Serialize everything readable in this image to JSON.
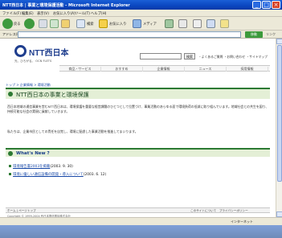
{
  "window": {
    "title": "NTT西日本 | 事業と環境保護活動 - Microsoft Internet Explorer",
    "controls": {
      "minimize": "_",
      "maximize": "□",
      "close": "×"
    }
  },
  "menu": [
    "ファイル(F)",
    "編集(E)",
    "表示(V)",
    "お気に入り(A)",
    "ツール(T)",
    "ヘルプ(H)"
  ],
  "toolbar": {
    "back_label": "戻る",
    "search_label": "検索",
    "favorites_label": "お気に入り",
    "media_label": "メディア"
  },
  "address": {
    "label": "アドレス(D)",
    "go_label": "移動",
    "links_label": "リンク"
  },
  "page": {
    "logo_name": "NTT西日本",
    "logo_sub": "光、ひろがる。 OCN FLETS",
    "search_button": "検索",
    "top_links": "・よくあるご質問 ・お問い合わせ ・サイトマップ",
    "global_nav": [
      "商品・サービス",
      "おすすめ",
      "企業情報",
      "ニュース",
      "採用情報"
    ],
    "breadcrumb": "トップ > 企業情報 > 環境活動",
    "heading": "NTT西日本の事業と環境保護",
    "para1": "西日本地域の通信事業を営むNTT西日本は、環境保護を重要な経営課題のひとつとして位置づけ、事業活動のあらゆる面で環境負荷の低減に取り組んでいます。地域社会との共生を図り、持続可能な社会の実現に貢献していきます。",
    "para2": "私たちは、企業市民としての責任を自覚し、環境に配慮した事業活動を推進してまいります。",
    "whats_new": "What's New ?",
    "news": [
      {
        "link": "環境報告書2003を掲載",
        "date": "(2003. 9. 30)"
      },
      {
        "link": "環境に優しい通信設備の開発・導入について",
        "date": "(2003. 6. 12)"
      }
    ],
    "footer_left": "ホーム | ページトップ",
    "footer_right": "このサイトについて　プライバシーポリシー",
    "copyright": "Copyright © 1999-2004 西日本電信電話株式会社"
  },
  "status": {
    "zone": "インターネット"
  }
}
